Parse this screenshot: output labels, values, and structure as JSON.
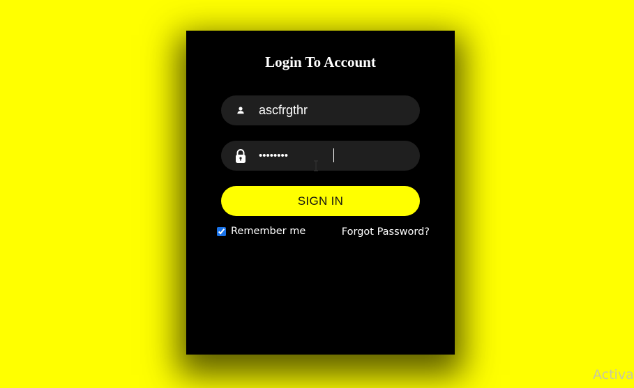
{
  "login": {
    "title": "Login To Account",
    "username": {
      "value": "ascfrgthr",
      "icon": "user-icon"
    },
    "password": {
      "value": "••••••••",
      "icon": "lock-icon"
    },
    "signin_label": "SIGN IN",
    "remember_label": "Remember me",
    "remember_checked": true,
    "forgot_label": "Forgot Password?"
  },
  "colors": {
    "background": "#ffff00",
    "card": "#000000",
    "field": "#1f1f1f",
    "button": "#ffff00",
    "checkbox": "#1a73e8"
  },
  "watermark": "Activat"
}
